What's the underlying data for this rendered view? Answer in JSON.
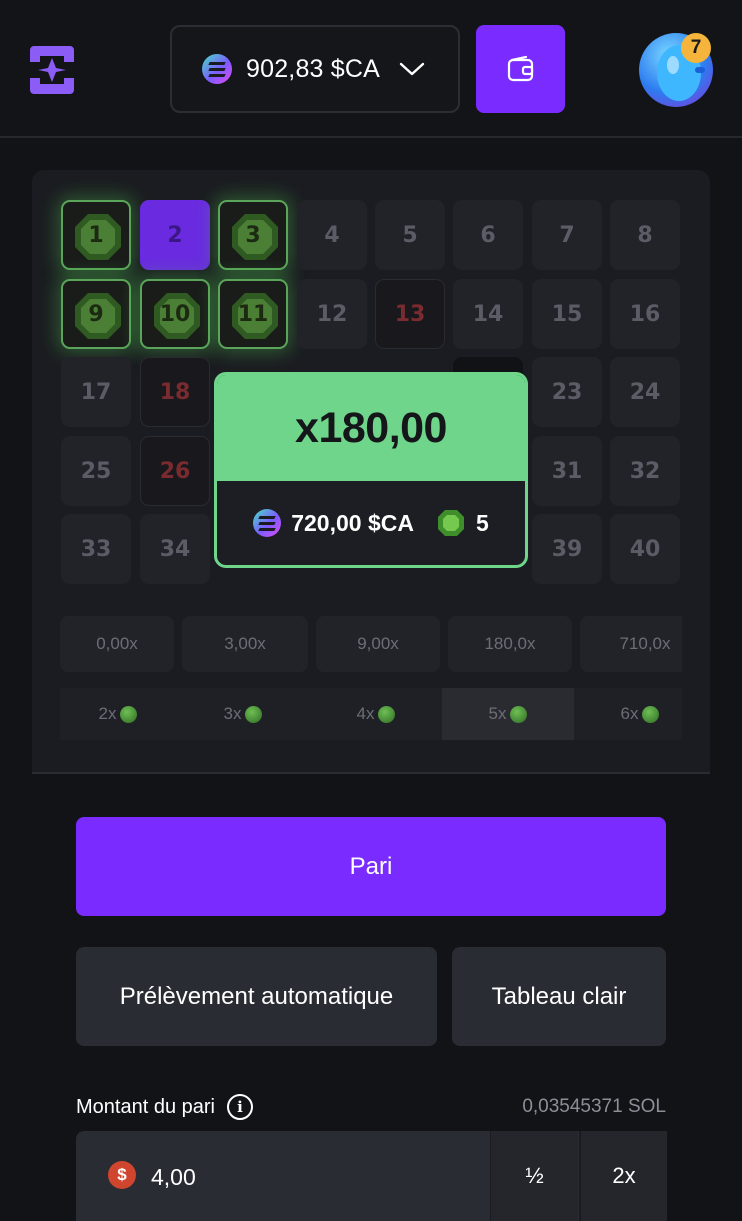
{
  "header": {
    "balance": "902,83 $CA",
    "avatar_badge": "7",
    "icons": [
      "logo-icon",
      "coin-icon",
      "chevron-down-icon",
      "wallet-icon"
    ]
  },
  "board": {
    "tiles": [
      {
        "n": "1",
        "state": "hit"
      },
      {
        "n": "2",
        "state": "selected"
      },
      {
        "n": "3",
        "state": "hit"
      },
      {
        "n": "4",
        "state": "normal"
      },
      {
        "n": "5",
        "state": "normal"
      },
      {
        "n": "6",
        "state": "normal"
      },
      {
        "n": "7",
        "state": "normal"
      },
      {
        "n": "8",
        "state": "normal"
      },
      {
        "n": "9",
        "state": "hit"
      },
      {
        "n": "10",
        "state": "hit"
      },
      {
        "n": "11",
        "state": "hit"
      },
      {
        "n": "12",
        "state": "normal"
      },
      {
        "n": "13",
        "state": "miss"
      },
      {
        "n": "14",
        "state": "normal"
      },
      {
        "n": "15",
        "state": "normal"
      },
      {
        "n": "16",
        "state": "normal"
      },
      {
        "n": "17",
        "state": "normal"
      },
      {
        "n": "18",
        "state": "miss"
      },
      {
        "n": "",
        "state": "hidden"
      },
      {
        "n": "",
        "state": "hidden"
      },
      {
        "n": "",
        "state": "hidden"
      },
      {
        "n": "",
        "state": "dark"
      },
      {
        "n": "23",
        "state": "normal"
      },
      {
        "n": "24",
        "state": "normal"
      },
      {
        "n": "25",
        "state": "normal"
      },
      {
        "n": "26",
        "state": "miss"
      },
      {
        "n": "",
        "state": "hidden"
      },
      {
        "n": "",
        "state": "hidden"
      },
      {
        "n": "",
        "state": "hidden"
      },
      {
        "n": "",
        "state": "hidden"
      },
      {
        "n": "31",
        "state": "normal"
      },
      {
        "n": "32",
        "state": "normal"
      },
      {
        "n": "33",
        "state": "normal"
      },
      {
        "n": "34",
        "state": "normal"
      },
      {
        "n": "",
        "state": "hidden"
      },
      {
        "n": "",
        "state": "hidden"
      },
      {
        "n": "",
        "state": "hidden"
      },
      {
        "n": "",
        "state": "hidden"
      },
      {
        "n": "39",
        "state": "normal"
      },
      {
        "n": "40",
        "state": "normal"
      }
    ],
    "multipliers": [
      "0,00x",
      "3,00x",
      "9,00x",
      "180,0x",
      "710,0x"
    ],
    "gem_counts": [
      "2x",
      "3x",
      "4x",
      "5x",
      "6x"
    ],
    "active_gem_index": 3
  },
  "popup": {
    "multiplier": "x180,00",
    "payout": "720,00 $CA",
    "gems": "5"
  },
  "controls": {
    "bet_label": "Pari",
    "auto_label": "Prélèvement automatique",
    "clear_label": "Tableau clair",
    "amount_label": "Montant du pari",
    "sol_value": "0,03545371 SOL",
    "amount_value": "4,00",
    "half_label": "½",
    "double_label": "2x"
  },
  "colors": {
    "accent": "#7a2bff",
    "win_green": "#6fd58a",
    "background": "#121317"
  }
}
